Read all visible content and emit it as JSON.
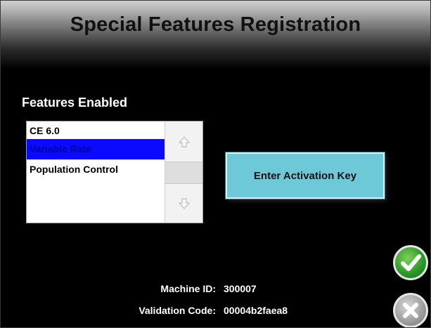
{
  "header": {
    "title": "Special Features Registration"
  },
  "features": {
    "label": "Features Enabled",
    "items": [
      {
        "label": "CE 6.0",
        "selected": false
      },
      {
        "label": "Variable Rate",
        "selected": true
      },
      {
        "label": "Population Control",
        "selected": false
      }
    ],
    "scroll_up_icon": "up-arrow-icon",
    "scroll_down_icon": "down-arrow-icon"
  },
  "activation": {
    "button_label": "Enter Activation Key"
  },
  "info": {
    "machine_id_label": "Machine ID:",
    "machine_id_value": "300007",
    "validation_code_label": "Validation Code:",
    "validation_code_value": "00004b2faea8"
  },
  "actions": {
    "accept_icon": "checkmark-icon",
    "cancel_icon": "x-icon",
    "accept_color": "#2f9a2b",
    "cancel_color": "#9c9c9c"
  },
  "colors": {
    "background": "#000000",
    "selection": "#0a0aff",
    "button_accent": "#6dc8d8"
  }
}
